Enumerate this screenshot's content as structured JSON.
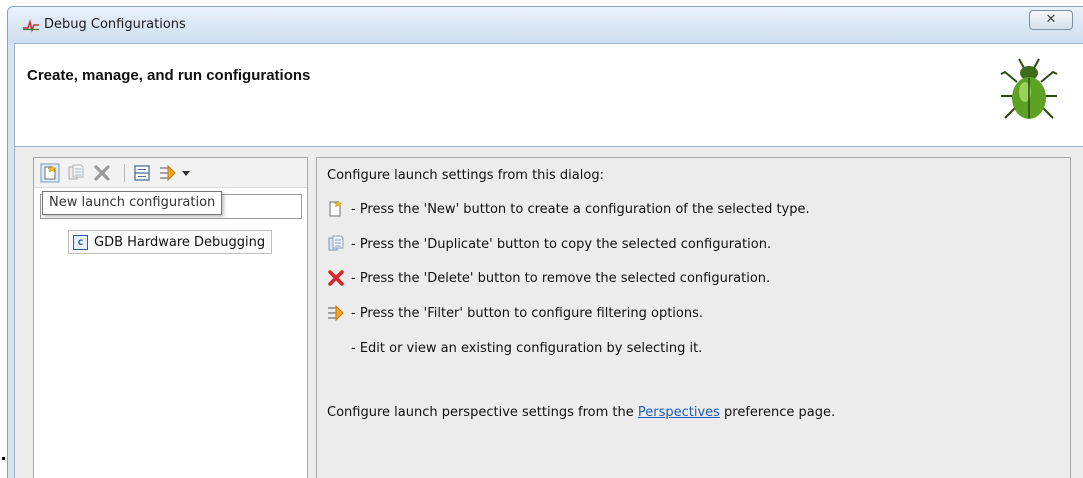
{
  "window": {
    "title": "Debug Configurations",
    "close_label": "✕"
  },
  "header": {
    "title": "Create, manage, and run configurations"
  },
  "left_panel": {
    "toolbar": [
      "new-launch-configuration",
      "duplicate",
      "delete",
      "collapse-all",
      "filter"
    ],
    "tooltip": "New launch configuration",
    "filter_value": "",
    "tree": [
      {
        "label": "GDB Hardware Debugging",
        "icon": "c-config-icon"
      }
    ]
  },
  "right_panel": {
    "intro": "Configure launch settings from this dialog:",
    "lines": [
      {
        "icon": "new-icon",
        "text": "- Press the 'New' button to create a configuration of the selected type."
      },
      {
        "icon": "duplicate-icon",
        "text": "- Press the 'Duplicate' button to copy the selected configuration."
      },
      {
        "icon": "delete-icon",
        "text": "- Press the 'Delete' button to remove the selected configuration."
      },
      {
        "icon": "filter-icon",
        "text": "- Press the 'Filter' button to configure filtering options."
      },
      {
        "icon": "",
        "text": "- Edit or view an existing configuration by selecting it."
      }
    ],
    "perspective_prefix": "Configure launch perspective settings from the ",
    "perspective_link": "Perspectives",
    "perspective_suffix": " preference page."
  },
  "colors": {
    "delete": "#d9262a",
    "link": "#1a5fb4",
    "accent": "#d6e3f2"
  }
}
